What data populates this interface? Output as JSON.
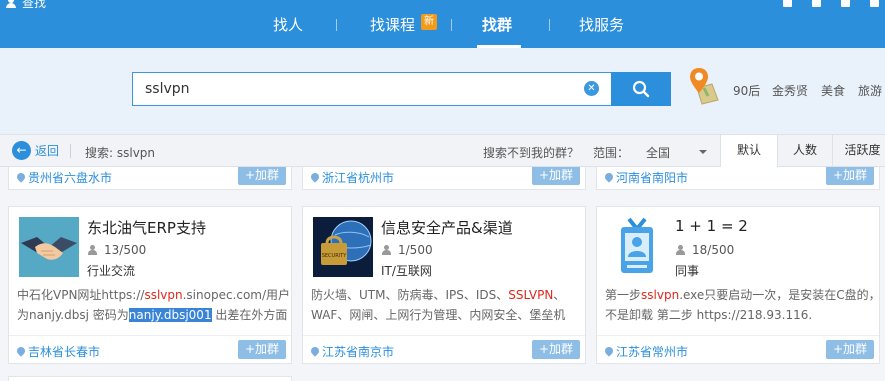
{
  "window": {
    "title": "查找"
  },
  "nav": {
    "items": [
      {
        "label": "找人"
      },
      {
        "label": "找课程"
      },
      {
        "label": "找群"
      },
      {
        "label": "找服务"
      }
    ],
    "new_badge": "新",
    "active_index": 2
  },
  "search": {
    "value": "sslvpn",
    "hot_tags": [
      "90后",
      "金秀贤",
      "美食",
      "旅游"
    ]
  },
  "filter": {
    "back_label": "返回",
    "query_text": "搜索: sslvpn",
    "not_found_text": "搜索不到我的群？",
    "range_label": "范围：",
    "range_value": "全国",
    "sort_tabs": [
      "默认",
      "人数",
      "活跃度"
    ],
    "active_sort": "默认"
  },
  "join_label": "+加群",
  "top_row_locations": [
    "贵州省六盘水市",
    "浙江省杭州市",
    "河南省南阳市"
  ],
  "cards": [
    {
      "title": "东北油气ERP支持",
      "count": "13/500",
      "category": "行业交流",
      "desc_parts": [
        {
          "text": "中石化VPN网址https://",
          "style": "normal"
        },
        {
          "text": "sslvpn",
          "style": "red"
        },
        {
          "text": ".sinopec.com/用户为nanjy.dbsj 密码为",
          "style": "normal"
        },
        {
          "text": "nanjy.dbsj001",
          "style": "selected"
        },
        {
          "text": " 出差在外方面",
          "style": "normal"
        }
      ],
      "location": "吉林省长春市"
    },
    {
      "title": "信息安全产品&渠道",
      "count": "1/500",
      "category": "IT/互联网",
      "desc_parts": [
        {
          "text": "防火墙、UTM、防病毒、IPS、IDS、",
          "style": "normal"
        },
        {
          "text": "SSLVPN",
          "style": "red"
        },
        {
          "text": "、WAF、网闸、上网行为管理、内网安全、堡垒机",
          "style": "normal"
        }
      ],
      "location": "江苏省南京市"
    },
    {
      "title": "1 + 1 = 2",
      "count": "18/500",
      "category": "同事",
      "desc_parts": [
        {
          "text": "第一步",
          "style": "normal"
        },
        {
          "text": "sslvpn",
          "style": "red"
        },
        {
          "text": ".exe只要启动一次，是安装在C盘的，不是卸载 第二步 https://218.93.116.",
          "style": "normal"
        }
      ],
      "location": "江苏省常州市"
    }
  ],
  "colors": {
    "brand": "#2b8fdc",
    "join_button": "#8ebde6",
    "highlight_red": "#e0281e",
    "selection": "#3a84d8"
  }
}
